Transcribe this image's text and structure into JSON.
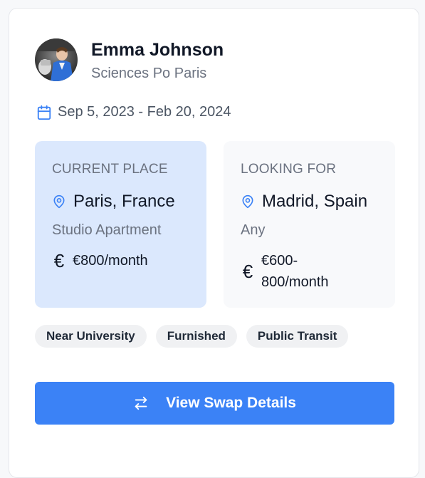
{
  "profile": {
    "name": "Emma Johnson",
    "school": "Sciences Po Paris"
  },
  "dates": {
    "range": "Sep 5, 2023 - Feb 20, 2024",
    "icon": "calendar-icon"
  },
  "current": {
    "title": "CURRENT PLACE",
    "location": "Paris, France",
    "type": "Studio Apartment",
    "price": "€800/month",
    "currency_symbol": "€"
  },
  "looking": {
    "title": "LOOKING FOR",
    "location": "Madrid, Spain",
    "type": "Any",
    "price": "€600-800/month",
    "currency_symbol": "€"
  },
  "tags": [
    "Near University",
    "Furnished",
    "Public Transit"
  ],
  "button": {
    "label": "View Swap Details",
    "icon": "swap-arrows-icon"
  },
  "colors": {
    "accent": "#3b82f6",
    "current_panel_bg": "#dbe8fd",
    "looking_panel_bg": "#f8f9fb"
  }
}
